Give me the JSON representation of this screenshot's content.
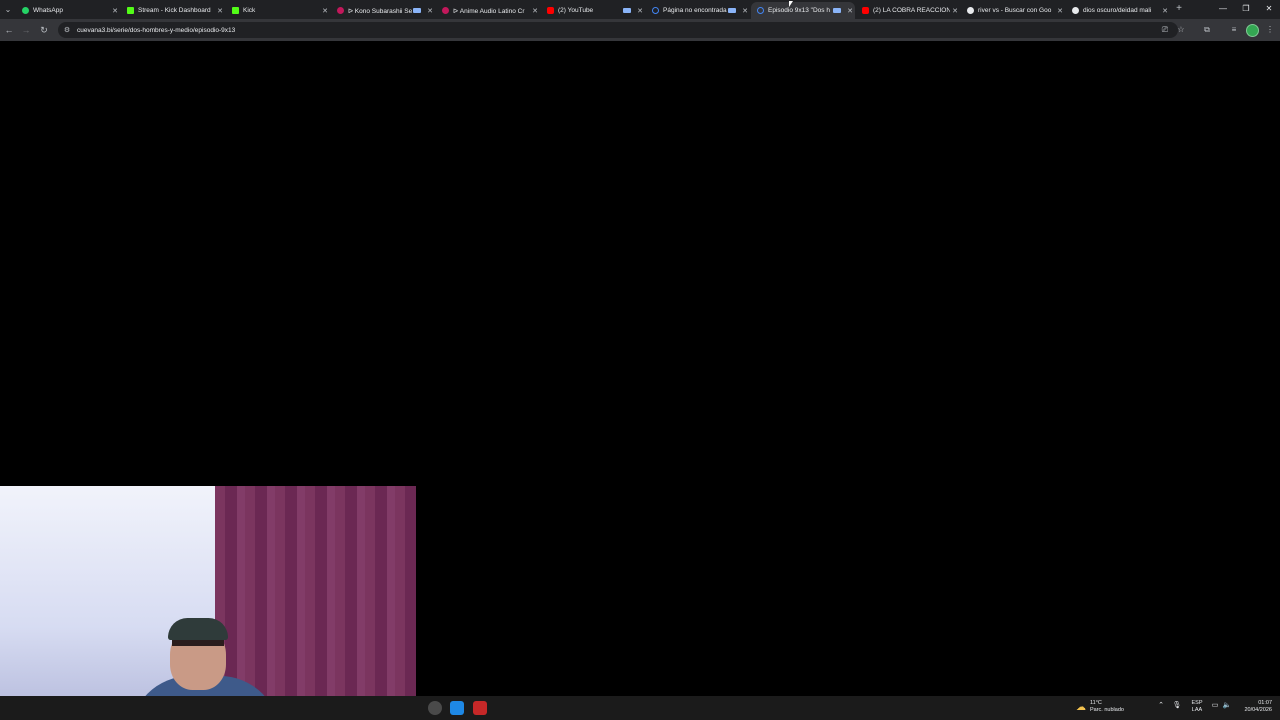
{
  "tabs": [
    {
      "title": "WhatsApp",
      "favicon_color": "#25d366",
      "has_audio": false,
      "active": false
    },
    {
      "title": "Stream - Kick Dashboard",
      "favicon_color": "#53fc18",
      "has_audio": false,
      "active": false
    },
    {
      "title": "Kick",
      "favicon_color": "#53fc18",
      "has_audio": false,
      "active": false
    },
    {
      "title": "ᐅ Kono Subarashii Se",
      "favicon_color": "#c2185b",
      "has_audio": true,
      "active": false
    },
    {
      "title": "ᐅ Anime Audio Latino Cr",
      "favicon_color": "#c2185b",
      "has_audio": false,
      "active": false
    },
    {
      "title": "(2) YouTube",
      "favicon_color": "#ff0000",
      "has_audio": true,
      "active": false
    },
    {
      "title": "Página no encontrada",
      "favicon_color": "#4285f4",
      "has_audio": true,
      "active": false
    },
    {
      "title": "Episodio 9x13 \"Dos h",
      "favicon_color": "#4285f4",
      "has_audio": true,
      "active": true
    },
    {
      "title": "(2) LA COBRA REACCION",
      "favicon_color": "#ff0000",
      "has_audio": false,
      "active": false
    },
    {
      "title": "river vs - Buscar con Goo",
      "favicon_color": "#e8eaed",
      "has_audio": false,
      "active": false
    },
    {
      "title": "dios oscuro/deidad mali",
      "favicon_color": "#e8eaed",
      "has_audio": false,
      "active": false
    }
  ],
  "address_bar": {
    "url": "cuevana3.bi/serie/dos-hombres-y-medio/episodio-9x13"
  },
  "taskbar": {
    "weather": {
      "temp": "11°C",
      "desc": "Parc. nublado"
    },
    "language": {
      "line1": "ESP",
      "line2": "LAA"
    },
    "clock": {
      "time": "01:07",
      "date": "20/04/2026"
    }
  }
}
